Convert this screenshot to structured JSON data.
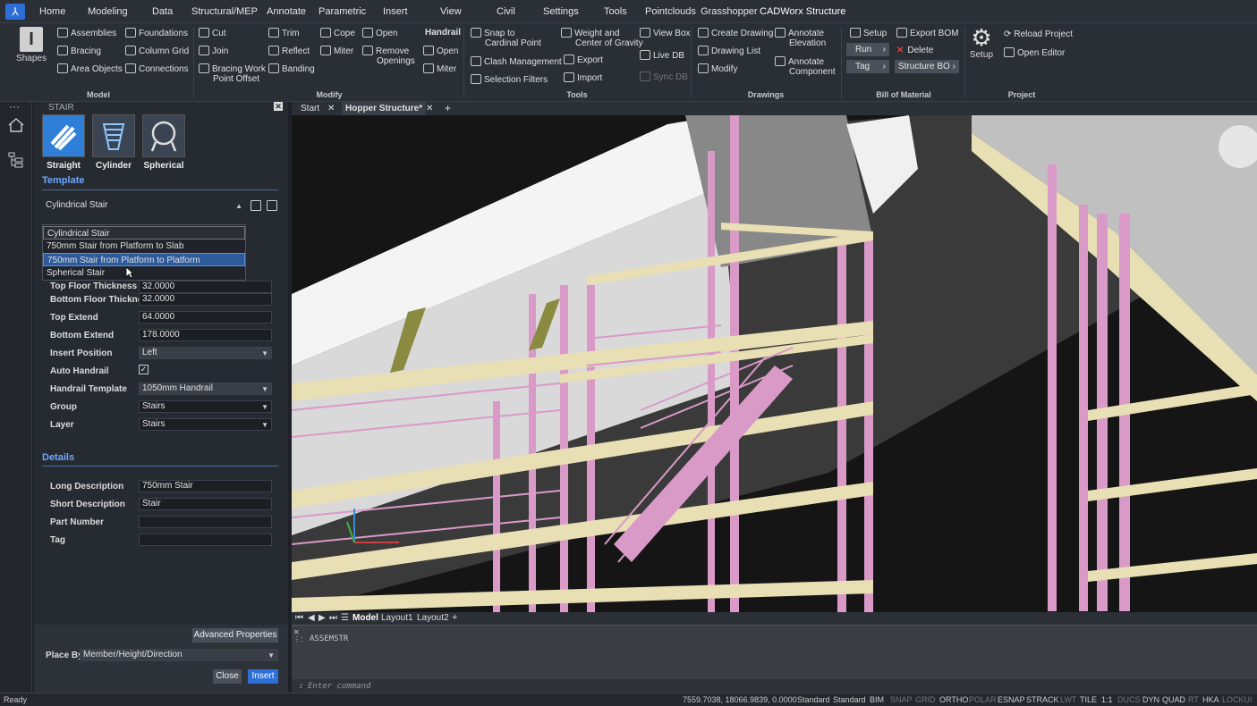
{
  "menu": {
    "items": [
      "Home",
      "Modeling",
      "Data",
      "Structural/MEP",
      "Annotate",
      "Parametric",
      "Insert",
      "View",
      "Civil",
      "Settings",
      "Tools",
      "Pointclouds",
      "Grasshopper",
      "CADWorx Structure"
    ]
  },
  "ribbon": {
    "model": {
      "title": "Model",
      "shapes": "Shapes",
      "assemblies": "Assemblies",
      "bracing": "Bracing",
      "area_objects": "Area Objects",
      "foundations": "Foundations",
      "column_grid": "Column Grid",
      "connections": "Connections"
    },
    "modify": {
      "title": "Modify",
      "cut": "Cut",
      "join": "Join",
      "bracing_work_point_offset_1": "Bracing Work",
      "bracing_work_point_offset_2": "Point Offset",
      "trim": "Trim",
      "reflect": "Reflect",
      "banding": "Banding",
      "cope": "Cope",
      "miter": "Miter",
      "open": "Open",
      "remove_openings_1": "Remove",
      "remove_openings_2": "Openings",
      "handrail": "Handrail",
      "handrail_open": "Open",
      "handrail_miter": "Miter"
    },
    "tools": {
      "title": "Tools",
      "snap_1": "Snap to",
      "snap_2": "Cardinal Point",
      "clash": "Clash Management",
      "selection": "Selection Filters",
      "weight_1": "Weight and",
      "weight_2": "Center of Gravity",
      "export": "Export",
      "import": "Import",
      "view_box": "View Box",
      "live_db": "Live DB",
      "sync_db": "Sync DB"
    },
    "drawings": {
      "title": "Drawings",
      "create": "Create Drawing",
      "list": "Drawing List",
      "modify": "Modify",
      "annotate_elev_1": "Annotate",
      "annotate_elev_2": "Elevation",
      "annotate_comp_1": "Annotate",
      "annotate_comp_2": "Component"
    },
    "bom": {
      "title": "Bill of Material",
      "setup": "Setup",
      "run": "Run",
      "tag": "Tag",
      "export_bom": "Export BOM",
      "delete": "Delete",
      "structure_bom": "Structure BO"
    },
    "project": {
      "title": "Project",
      "setup": "Setup",
      "reload": "Reload Project",
      "open_editor": "Open Editor"
    }
  },
  "panel": {
    "header": "STAIR",
    "types": [
      "Straight",
      "Cylinder",
      "Spherical"
    ],
    "template_head": "Template",
    "template_value": "Cylindrical Stair",
    "dropdown": [
      "Cylindrical Stair",
      "750mm Stair from Platform to Slab",
      "750mm Stair from Platform to Platform",
      "Spherical Stair"
    ],
    "props": [
      {
        "label": "Top Floor Thickness",
        "value": "32.0000"
      },
      {
        "label": "Bottom Floor Thickness",
        "value": "32.0000"
      },
      {
        "label": "Top Extend",
        "value": "64.0000"
      },
      {
        "label": "Bottom Extend",
        "value": "178.0000"
      },
      {
        "label": "Insert Position",
        "value": "Left"
      },
      {
        "label": "Auto Handrail",
        "value": "✓"
      },
      {
        "label": "Handrail Template",
        "value": "1050mm Handrail"
      },
      {
        "label": "Group",
        "value": "Stairs"
      },
      {
        "label": "Layer",
        "value": "Stairs"
      }
    ],
    "details_head": "Details",
    "details": [
      {
        "label": "Long Description",
        "value": "750mm Stair"
      },
      {
        "label": "Short Description",
        "value": "Stair"
      },
      {
        "label": "Part Number",
        "value": ""
      },
      {
        "label": "Tag",
        "value": ""
      }
    ],
    "advanced": "Advanced Properties",
    "place_by_label": "Place By",
    "place_by_value": "Member/Height/Direction",
    "close": "Close",
    "insert": "Insert"
  },
  "doc_tabs": [
    "Start",
    "Hopper Structure*"
  ],
  "layout_tabs": [
    "Model",
    "Layout1",
    "Layout2"
  ],
  "command": {
    "history": "ASSEMSTR",
    "placeholder": "Enter command"
  },
  "status": {
    "ready": "Ready",
    "coords": "7559.7038, 18066.9839, 0.0000",
    "items": [
      "Standard",
      "Standard",
      "BIM",
      "SNAP",
      "GRID",
      "ORTHO",
      "POLAR",
      "ESNAP",
      "STRACK",
      "LWT",
      "TILE",
      "1:1",
      "DUCS",
      "DYN",
      "QUAD",
      "RT",
      "HKA",
      "LOCKUI"
    ]
  },
  "colors": {
    "accent": "#6fa8ff",
    "selected": "#2d5a9a",
    "steel_pink": "#d99ac8",
    "steel_cream": "#e8dfb4"
  }
}
